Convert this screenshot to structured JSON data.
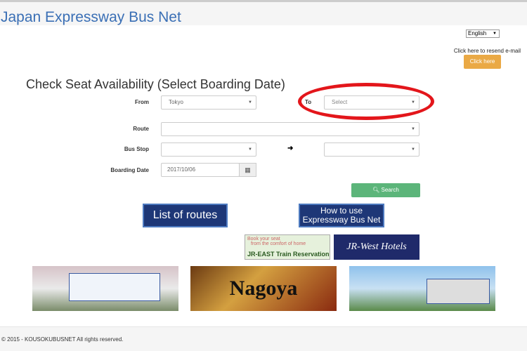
{
  "header": {
    "title": "Japan Expressway Bus Net"
  },
  "language": {
    "selected": "English"
  },
  "resend": {
    "text": "Click here to resend e-mail",
    "button": "Click here"
  },
  "form": {
    "heading": "Check Seat Availability (Select Boarding Date)",
    "from_label": "From",
    "from_value": "Tokyo",
    "to_label": "To",
    "to_value": "Select",
    "route_label": "Route",
    "route_value": "",
    "bus_stop_label": "Bus Stop",
    "bus_stop_from": "",
    "bus_stop_to": "",
    "date_label": "Boarding Date",
    "date_value": "2017/10/06",
    "search_label": "Search"
  },
  "links": {
    "routes": "List of routes",
    "how_to_1": "How to use",
    "how_to_2": "Expressway Bus Net",
    "jreast_1": "Book your seat",
    "jreast_2": "from the comfort of home",
    "jreast_3": "JR-EAST Train Reservation",
    "jrwest": "JR-West Hotels"
  },
  "banners": {
    "nagoya": "Nagoya"
  },
  "annotation": {
    "color": "#e3161b"
  },
  "footer": {
    "copyright": "© 2015 - KOUSOKUBUSNET All rights reserved."
  }
}
